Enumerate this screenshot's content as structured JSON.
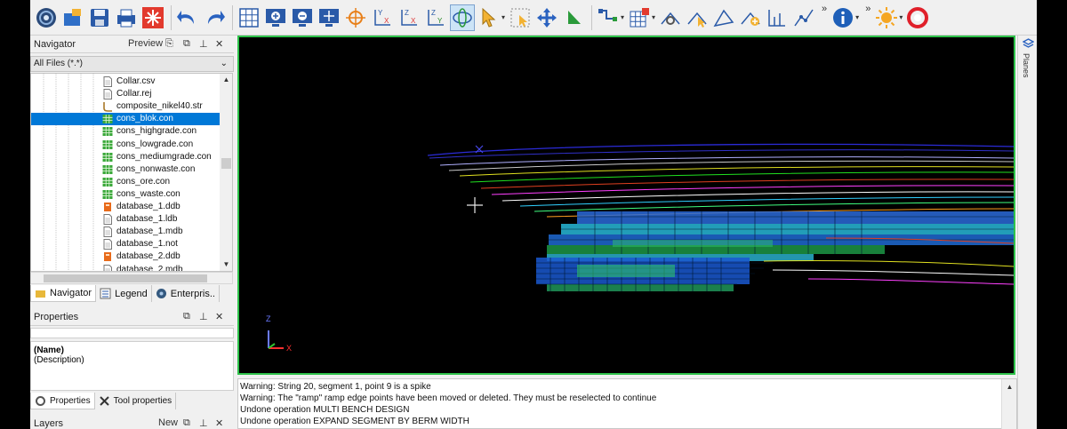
{
  "navigator": {
    "title": "Navigator",
    "preview_label": "Preview",
    "filter": "All Files (*.*)",
    "files": [
      {
        "name": "Collar.csv",
        "icon": "text-file-icon"
      },
      {
        "name": "Collar.rej",
        "icon": "text-file-icon"
      },
      {
        "name": "composite_nikel40.str",
        "icon": "string-file-icon"
      },
      {
        "name": "cons_blok.con",
        "icon": "constraint-file-icon",
        "selected": true
      },
      {
        "name": "cons_highgrade.con",
        "icon": "constraint-file-icon"
      },
      {
        "name": "cons_lowgrade.con",
        "icon": "constraint-file-icon"
      },
      {
        "name": "cons_mediumgrade.con",
        "icon": "constraint-file-icon"
      },
      {
        "name": "cons_nonwaste.con",
        "icon": "constraint-file-icon"
      },
      {
        "name": "cons_ore.con",
        "icon": "constraint-file-icon"
      },
      {
        "name": "cons_waste.con",
        "icon": "constraint-file-icon"
      },
      {
        "name": "database_1.ddb",
        "icon": "database-file-icon"
      },
      {
        "name": "database_1.ldb",
        "icon": "text-file-icon"
      },
      {
        "name": "database_1.mdb",
        "icon": "text-file-icon"
      },
      {
        "name": "database_1.not",
        "icon": "text-file-icon"
      },
      {
        "name": "database_2.ddb",
        "icon": "database-file-icon"
      },
      {
        "name": "database_2.mdb",
        "icon": "text-file-icon"
      }
    ],
    "tabs": [
      "Navigator",
      "Legend",
      "Enterpris.."
    ]
  },
  "properties": {
    "title": "Properties",
    "name_label": "(Name)",
    "description_label": "(Description)",
    "tabs": [
      "Properties",
      "Tool properties"
    ]
  },
  "layers": {
    "title": "Layers",
    "new_label": "New"
  },
  "viewport": {
    "axis_z": "Z",
    "axis_x": "X"
  },
  "right_panel": {
    "planes_label": "Planes"
  },
  "log": {
    "lines": [
      "Warning: String 20, segment 1, point 9 is a spike",
      "Warning: The \"ramp\" ramp edge points have been moved or deleted. They must be reselected to continue",
      "Undone operation MULTI BENCH DESIGN",
      "Undone operation EXPAND SEGMENT BY BERM WIDTH"
    ]
  },
  "colors": {
    "viewport_border": "#2ec24a",
    "selection": "#0078d7"
  }
}
